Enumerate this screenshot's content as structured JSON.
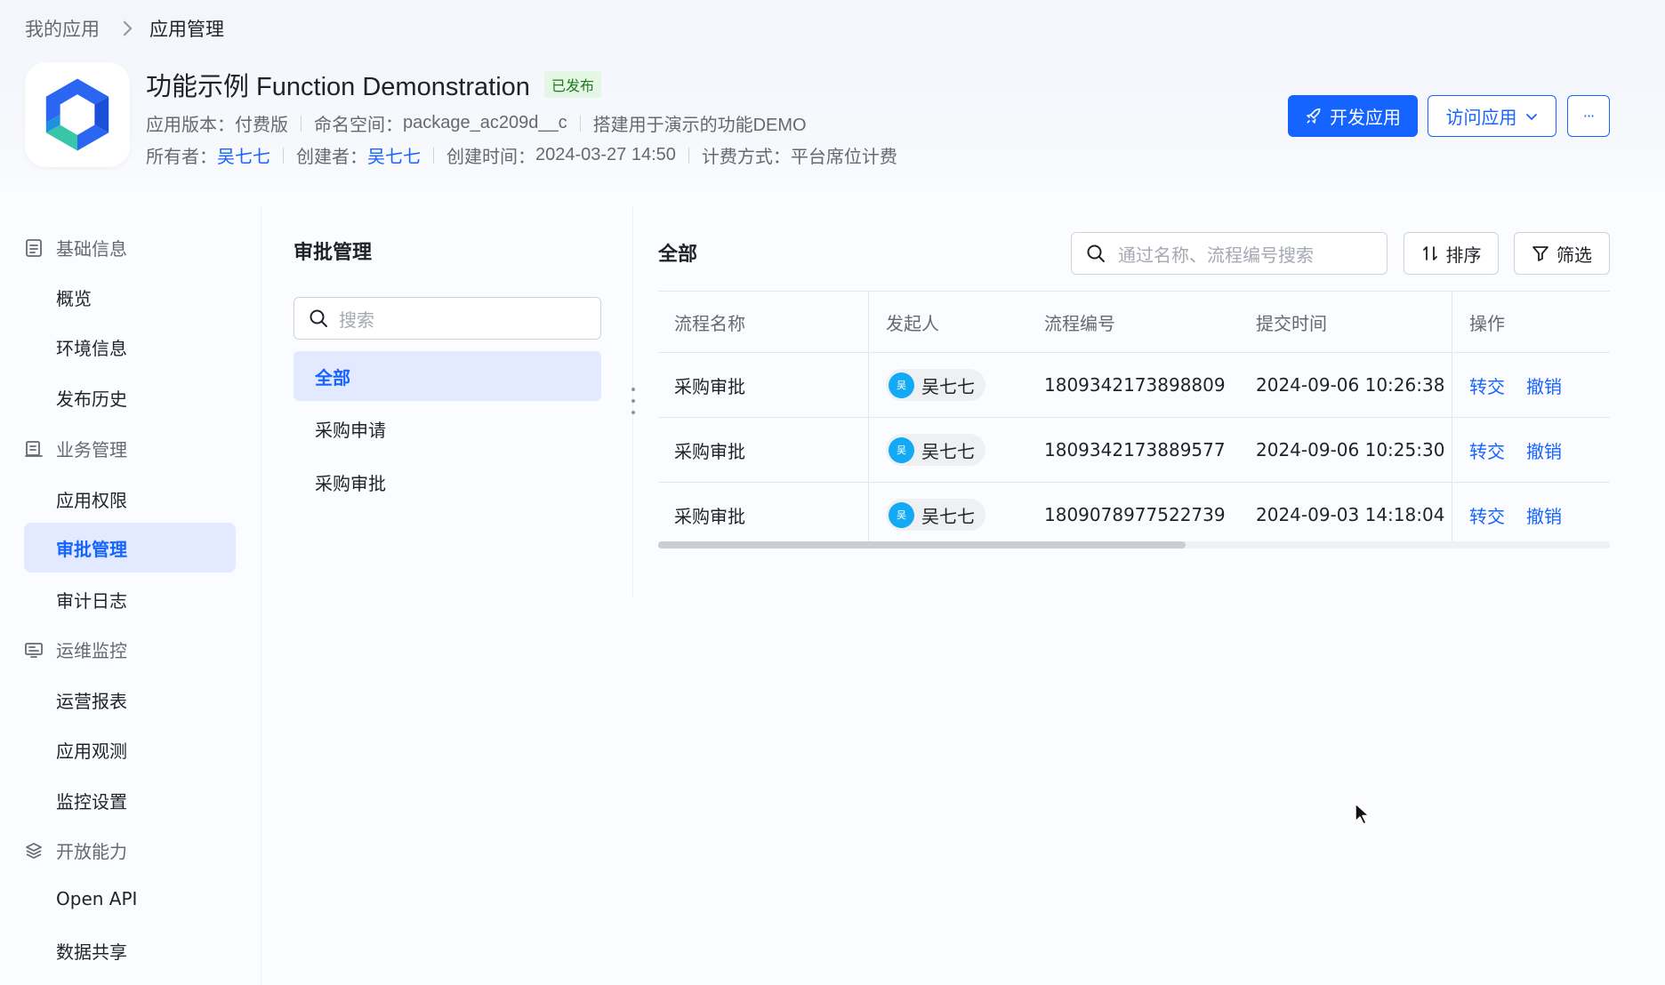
{
  "breadcrumb": {
    "parent": "我的应用",
    "current": "应用管理"
  },
  "app": {
    "title": "功能示例 Function Demonstration",
    "status": "已发布",
    "version_label": "应用版本：",
    "version": "付费版",
    "namespace_label": "命名空间：",
    "namespace": "package_ac209d__c",
    "description": "搭建用于演示的功能DEMO",
    "owner_label": "所有者：",
    "owner": "吴七七",
    "creator_label": "创建者：",
    "creator": "吴七七",
    "created_label": "创建时间：",
    "created": "2024-03-27 14:50",
    "billing_label": "计费方式：",
    "billing": "平台席位计费"
  },
  "actions": {
    "develop": "开发应用",
    "visit": "访问应用",
    "more": "···"
  },
  "colors": {
    "accent": "#1664ff",
    "avatar": "#14a9f5",
    "active_bg": "#e3eaff",
    "published_badge": "#e4f6e4"
  },
  "sidebar": {
    "groups": [
      {
        "label": "基础信息",
        "icon": "document-icon",
        "items": [
          "概览",
          "环境信息",
          "发布历史"
        ]
      },
      {
        "label": "业务管理",
        "icon": "briefcase-icon",
        "items": [
          "应用权限",
          "审批管理",
          "审计日志"
        ]
      },
      {
        "label": "运维监控",
        "icon": "monitor-icon",
        "items": [
          "运营报表",
          "应用观测",
          "监控设置"
        ]
      },
      {
        "label": "开放能力",
        "icon": "layers-icon",
        "items": [
          "Open API",
          "数据共享"
        ]
      }
    ],
    "active": "审批管理"
  },
  "approval": {
    "title": "审批管理",
    "search_placeholder": "搜索",
    "categories": [
      "全部",
      "采购申请",
      "采购审批"
    ],
    "active_category": "全部"
  },
  "list": {
    "title": "全部",
    "search_placeholder": "通过名称、流程编号搜索",
    "sort_label": "排序",
    "filter_label": "筛选",
    "columns": [
      "流程名称",
      "发起人",
      "流程编号",
      "提交时间",
      "操作"
    ],
    "rows": [
      {
        "name": "采购审批",
        "initiator": "吴七七",
        "initial": "吴",
        "id": "1809342173898809",
        "time": "2024-09-06 10:26:38",
        "op1": "转交",
        "op2": "撤销"
      },
      {
        "name": "采购审批",
        "initiator": "吴七七",
        "initial": "吴",
        "id": "1809342173889577",
        "time": "2024-09-06 10:25:30",
        "op1": "转交",
        "op2": "撤销"
      },
      {
        "name": "采购审批",
        "initiator": "吴七七",
        "initial": "吴",
        "id": "1809078977522739",
        "time": "2024-09-03 14:18:04",
        "op1": "转交",
        "op2": "撤销"
      }
    ]
  }
}
